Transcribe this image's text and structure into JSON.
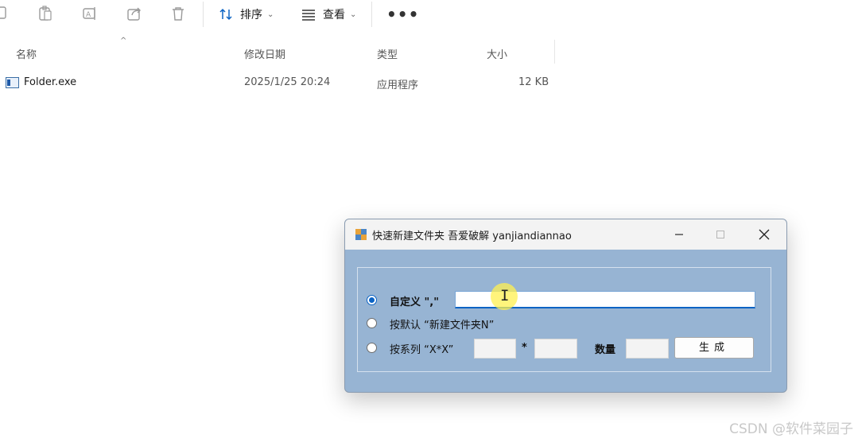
{
  "toolbar": {
    "sort_label": "排序",
    "view_label": "查看",
    "more_label": "•••",
    "icons": [
      "copy-icon",
      "paste-icon",
      "rename-icon",
      "share-icon",
      "delete-icon",
      "sort-icon",
      "view-icon"
    ]
  },
  "columns": {
    "name": "名称",
    "modified": "修改日期",
    "type": "类型",
    "size": "大小"
  },
  "files": [
    {
      "name": "Folder.exe",
      "modified": "2025/1/25 20:24",
      "type": "应用程序",
      "size": "12 KB"
    }
  ],
  "dialog": {
    "title": "快速新建文件夹 吾爱破解 yanjiandiannao",
    "option_custom": "自定义 \",\"",
    "custom_value": "",
    "option_default": "按默认 “新建文件夹N”",
    "option_series": "按系列 “X*X”",
    "times_sign": "*",
    "count_label": "数量",
    "generate_label": "生成",
    "selected_option": "custom"
  },
  "watermark": "CSDN @软件菜园子"
}
